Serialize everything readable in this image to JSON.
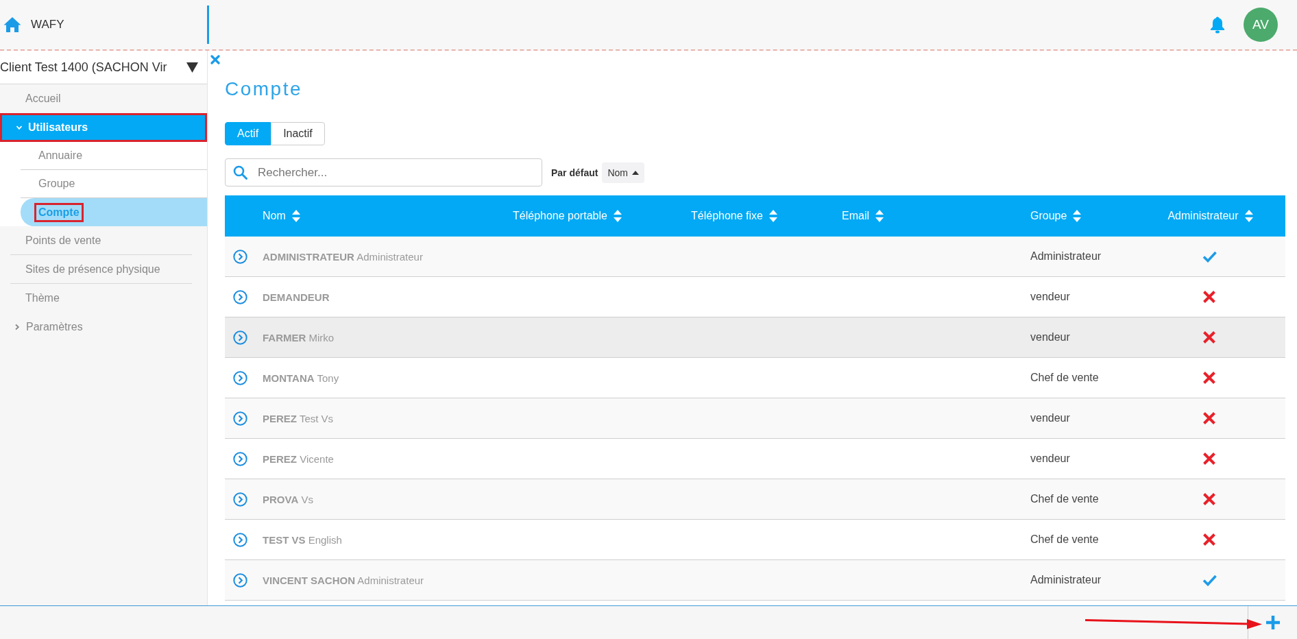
{
  "header": {
    "brand": "WAFY",
    "avatar": "AV"
  },
  "sidebar": {
    "client": "Client Test 1400 (SACHON Vir",
    "items": [
      {
        "kind": "link",
        "label": "Accueil",
        "selected": false,
        "annotated": false
      },
      {
        "kind": "group",
        "label": "Utilisateurs",
        "selected": true,
        "expanded": true,
        "annotated": true,
        "children": [
          {
            "label": "Annuaire",
            "selected": false,
            "annotated": false
          },
          {
            "label": "Groupe",
            "selected": false,
            "annotated": false
          },
          {
            "label": "Compte",
            "selected": true,
            "annotated": true
          }
        ]
      },
      {
        "kind": "link",
        "label": "Points de vente",
        "selected": false,
        "annotated": false
      },
      {
        "kind": "link",
        "label": "Sites de présence physique",
        "selected": false,
        "annotated": false
      },
      {
        "kind": "link",
        "label": "Thème",
        "selected": false,
        "annotated": false
      },
      {
        "kind": "group",
        "label": "Paramètres",
        "selected": false,
        "expanded": false,
        "annotated": false
      }
    ]
  },
  "page": {
    "title": "Compte",
    "tabs": [
      {
        "label": "Actif",
        "selected": true
      },
      {
        "label": "Inactif",
        "selected": false
      }
    ],
    "search": {
      "placeholder": "Rechercher..."
    },
    "sort": {
      "label": "Par défaut",
      "field": "Nom",
      "ascending": true
    }
  },
  "table": {
    "columns": [
      "Nom",
      "Téléphone portable",
      "Téléphone fixe",
      "Email",
      "Groupe",
      "Administrateur"
    ],
    "rows": [
      {
        "name": "**ADMINISTRATEUR** Administrateur",
        "group": "Administrateur",
        "admin": true,
        "highlighted": false
      },
      {
        "name": "**DEMANDEUR**",
        "group": "vendeur",
        "admin": false,
        "highlighted": false
      },
      {
        "name": "**FARMER** Mirko",
        "group": "vendeur",
        "admin": false,
        "highlighted": true
      },
      {
        "name": "**MONTANA** Tony",
        "group": "Chef de vente",
        "admin": false,
        "highlighted": false
      },
      {
        "name": "**PEREZ** Test Vs",
        "group": "vendeur",
        "admin": false,
        "highlighted": false
      },
      {
        "name": "**PEREZ** Vicente",
        "group": "vendeur",
        "admin": false,
        "highlighted": false
      },
      {
        "name": "**PROVA** Vs",
        "group": "Chef de vente",
        "admin": false,
        "highlighted": false
      },
      {
        "name": "**TEST VS** English",
        "group": "Chef de vente",
        "admin": false,
        "highlighted": false
      },
      {
        "name": "**VINCENT SACHON** Administrateur",
        "group": "Administrateur",
        "admin": true,
        "highlighted": false
      }
    ]
  },
  "footer": {
    "annotation_arrow": true
  }
}
